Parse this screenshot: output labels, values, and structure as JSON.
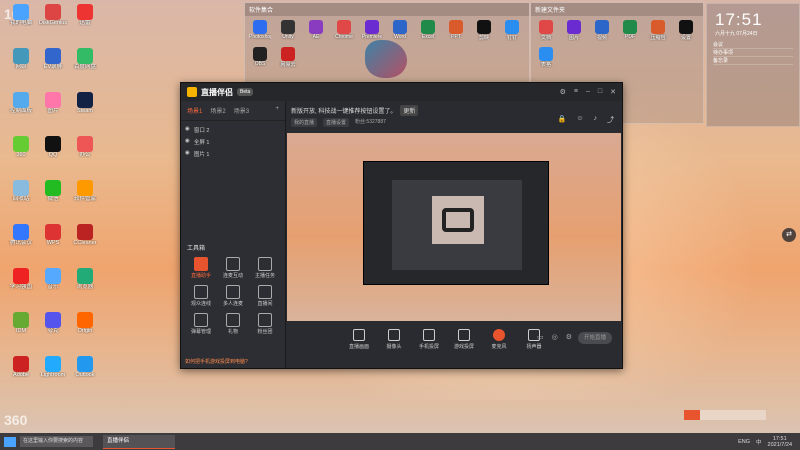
{
  "desktop": {
    "corner_logo": "10",
    "bottom_logo": "360",
    "left_icons": [
      {
        "label": "我的电脑",
        "color": "#4aa3ff"
      },
      {
        "label": "DiskGenius",
        "color": "#d44"
      },
      {
        "label": "迅雷",
        "color": "#e33"
      },
      {
        "label": "网络",
        "color": "#49b"
      },
      {
        "label": "EV录屏",
        "color": "#36c"
      },
      {
        "label": "百度网盘",
        "color": "#3b6"
      },
      {
        "label": "控制面板",
        "color": "#5ae"
      },
      {
        "label": "图片",
        "color": "#f7a"
      },
      {
        "label": "Steam",
        "color": "#124"
      },
      {
        "label": "360",
        "color": "#6c3"
      },
      {
        "label": "QQ",
        "color": "#111"
      },
      {
        "label": "办公",
        "color": "#e55"
      },
      {
        "label": "回收站",
        "color": "#8bd"
      },
      {
        "label": "微信",
        "color": "#2b2"
      },
      {
        "label": "软件管家",
        "color": "#f90"
      },
      {
        "label": "腾讯会议",
        "color": "#37f"
      },
      {
        "label": "WPS",
        "color": "#d33"
      },
      {
        "label": "CCleaner",
        "color": "#b22"
      },
      {
        "label": "学习强国",
        "color": "#e22"
      },
      {
        "label": "音乐",
        "color": "#5af"
      },
      {
        "label": "浏览器",
        "color": "#2a7"
      },
      {
        "label": "IDM",
        "color": "#6a3"
      },
      {
        "label": "夸克",
        "color": "#55e"
      },
      {
        "label": "Origin",
        "color": "#f60"
      },
      {
        "label": "Adobe",
        "color": "#c22"
      },
      {
        "label": "Lightroom",
        "color": "#2af"
      },
      {
        "label": "Outlook",
        "color": "#29e"
      }
    ]
  },
  "fences": [
    {
      "title": "软件集合",
      "icons": [
        "Photoshop",
        "Unity",
        "AE",
        "Chrome",
        "Premiere",
        "Word",
        "Excel",
        "PPT",
        "剪映",
        "钉钉",
        "OBS",
        "网易云"
      ]
    },
    {
      "title": "新建文件夹",
      "icons": [
        "文档",
        "图片",
        "视频",
        "PDF",
        "压缩包",
        "设置",
        "表格"
      ]
    }
  ],
  "clock_widget": {
    "time": "17:51",
    "date": "六月十九 07月24日",
    "memo": [
      "会议",
      "待办事项",
      "备忘录"
    ]
  },
  "app": {
    "name": "直播伴侣",
    "badge": "Beta",
    "tabs": [
      "场景1",
      "场景2",
      "场景3"
    ],
    "scenes": [
      "窗口 2",
      "全屏 1",
      "图片 1"
    ],
    "tools_title": "工具箱",
    "tools": [
      "直播助手",
      "连麦互动",
      "主播任务",
      "观众连线",
      "多人连麦",
      "直播间",
      "弹幕管理",
      "礼物",
      "粉丝团"
    ],
    "footer": "如何把手机游戏投屏到电脑?",
    "notice": "新版开放, 科技战一键推荐按钮设置了。",
    "notice_btn": "更新",
    "stats": [
      "我的直播",
      "直播设置",
      "粉丝:5327887"
    ],
    "bottom_items": [
      "直播画面",
      "摄像头",
      "手机投屏",
      "游戏投屏",
      "麦克风",
      "扬声器"
    ],
    "live_btn": "开始直播"
  },
  "taskbar": {
    "search": "在这里输入你要搜索的内容",
    "task": "直播伴侣",
    "tray": [
      "ENG",
      "中"
    ],
    "tray_time": "17:51",
    "tray_date": "2021/7/24"
  },
  "progress": 0.2,
  "side_button": "⇄"
}
